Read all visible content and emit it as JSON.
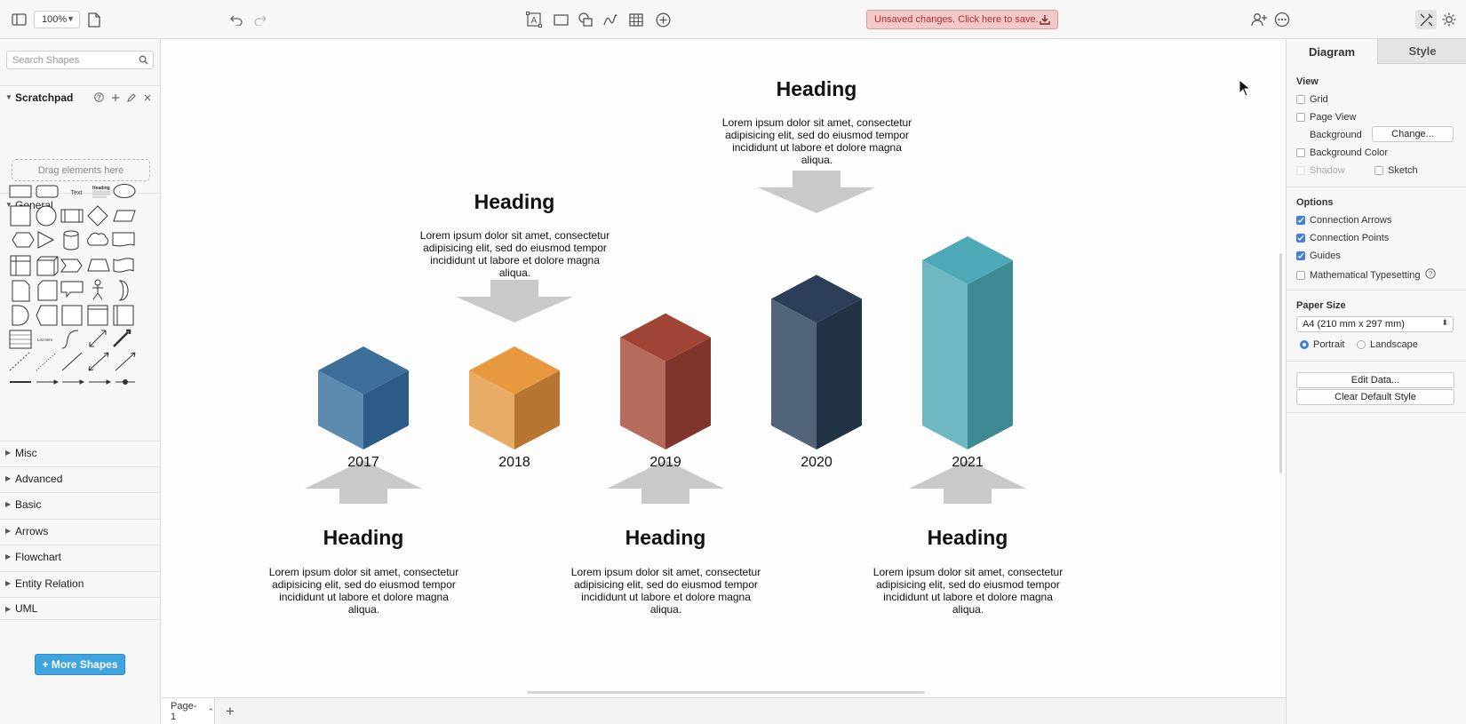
{
  "toolbar": {
    "zoom": "100%",
    "save_banner": "Unsaved changes. Click here to save."
  },
  "sidebar": {
    "search_placeholder": "Search Shapes",
    "scratchpad": "Scratchpad",
    "drop_hint": "Drag elements here",
    "general": "General",
    "sections": [
      "Misc",
      "Advanced",
      "Basic",
      "Arrows",
      "Flowchart",
      "Entity Relation",
      "UML"
    ],
    "more_shapes": "+ More Shapes",
    "palette_text": "Text",
    "palette_heading": "Heading",
    "palette_list_item": "List Item"
  },
  "diagram": {
    "items": [
      {
        "year": "2017",
        "heading": "Heading",
        "body": "Lorem ipsum dolor sit amet, consectetur adipisicing elit, sed do eiusmod tempor incididunt ut labore et dolore magna aliqua.",
        "color_top": "#3c6f9a",
        "color_left": "#5d8bb0",
        "color_right": "#2b5b86",
        "height_units": 1
      },
      {
        "year": "2018",
        "heading": "Heading",
        "body": "Lorem ipsum dolor sit amet, consectetur adipisicing elit, sed do eiusmod tempor incididunt ut labore et dolore magna aliqua.",
        "color_top": "#e8983f",
        "color_left": "#e8ac66",
        "color_right": "#b67530",
        "height_units": 1
      },
      {
        "year": "2019",
        "heading": "Heading",
        "body": "Lorem ipsum dolor sit amet, consectetur adipisicing elit, sed do eiusmod tempor incididunt ut labore et dolore magna aliqua.",
        "color_top": "#a04535",
        "color_left": "#b56c5c",
        "color_right": "#80362b",
        "height_units": 1.6
      },
      {
        "year": "2020",
        "heading": "Heading",
        "body": "Lorem ipsum dolor sit amet, consectetur adipisicing elit, sed do eiusmod tempor incididunt ut labore et dolore magna aliqua.",
        "color_top": "#2d3f58",
        "color_left": "#526479",
        "color_right": "#223345",
        "height_units": 2.3
      },
      {
        "year": "2021",
        "heading": "Heading",
        "body": "Lorem ipsum dolor sit amet, consectetur adipisicing elit, sed do eiusmod tempor incididunt ut labore et dolore magna aliqua.",
        "color_top": "#4ea9b6",
        "color_left": "#6fb8c2",
        "color_right": "#3d8a92",
        "height_units": 3
      }
    ],
    "arrow_color": "#c9c9c9"
  },
  "bottom": {
    "page_tab": "Page-1"
  },
  "panel": {
    "tab_diagram": "Diagram",
    "tab_style": "Style",
    "view": "View",
    "grid": "Grid",
    "page_view": "Page View",
    "background": "Background",
    "change": "Change...",
    "background_color": "Background Color",
    "shadow": "Shadow",
    "sketch": "Sketch",
    "options": "Options",
    "connection_arrows": "Connection Arrows",
    "connection_points": "Connection Points",
    "guides": "Guides",
    "math": "Mathematical Typesetting",
    "paper_size": "Paper Size",
    "paper_value": "A4 (210 mm x 297 mm)",
    "portrait": "Portrait",
    "landscape": "Landscape",
    "edit_data": "Edit Data...",
    "clear_style": "Clear Default Style",
    "accent": "#3f7fd9"
  }
}
